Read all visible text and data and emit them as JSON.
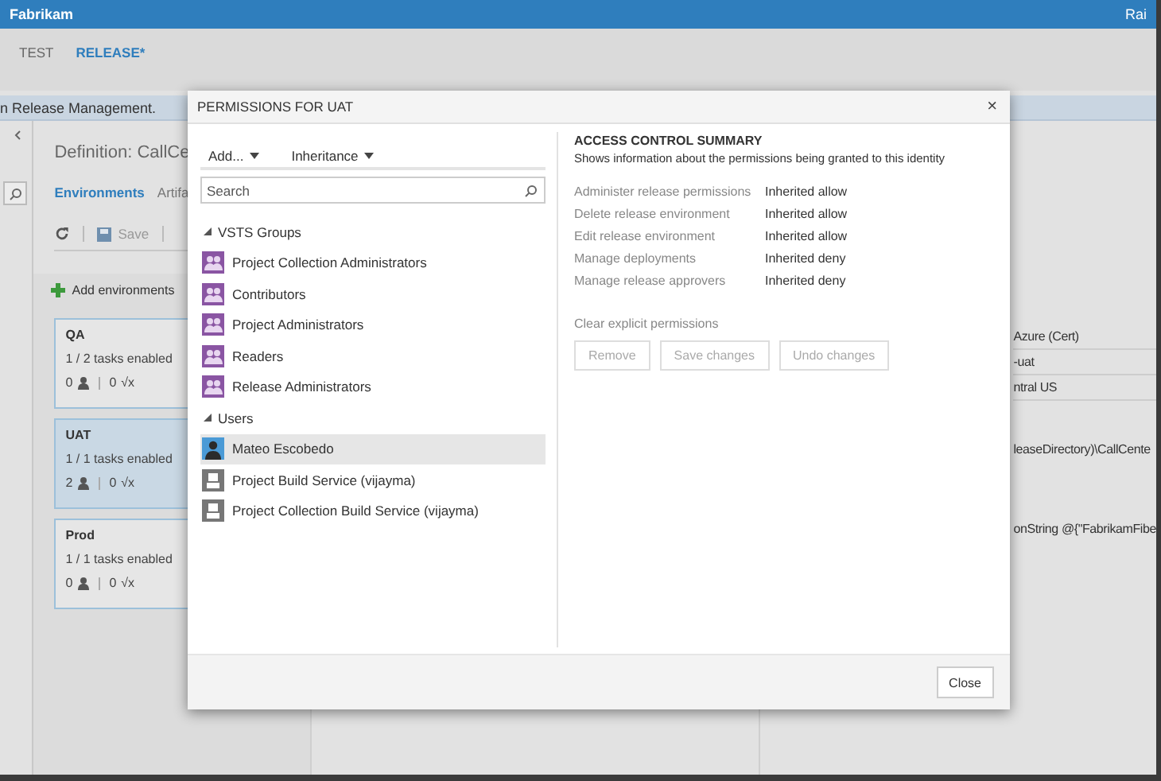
{
  "app": {
    "brand": "Fabrikam",
    "user": "Rai",
    "nav": [
      {
        "label": "TEST",
        "selected": false
      },
      {
        "label": "RELEASE*",
        "selected": true
      }
    ],
    "banner": "n Release Management.",
    "definition_title": "Definition: CallCe",
    "tabs": [
      {
        "label": "Environments",
        "selected": true
      },
      {
        "label": "Artifa",
        "selected": false
      }
    ],
    "toolbar": {
      "save": "Save"
    },
    "add_environments": "Add environments",
    "environments": [
      {
        "name": "QA",
        "tasks": "1 / 2 tasks enabled",
        "approvers": "0",
        "variables": "0",
        "variables_icon": "√x",
        "selected": false
      },
      {
        "name": "UAT",
        "tasks": "1 / 1 tasks enabled",
        "approvers": "2",
        "variables": "0",
        "variables_icon": "√x",
        "selected": true
      },
      {
        "name": "Prod",
        "tasks": "1 / 1 tasks enabled",
        "approvers": "0",
        "variables": "0",
        "variables_icon": "√x",
        "selected": false
      }
    ],
    "properties": [
      "Azure (Cert)",
      "-uat",
      "ntral US",
      "leaseDirectory)\\CallCente",
      "onString @{\"FabrikamFibe"
    ]
  },
  "dialog": {
    "title": "PERMISSIONS FOR UAT",
    "close": "×",
    "menus": [
      "Add...",
      "Inheritance"
    ],
    "search": {
      "placeholder": "Search"
    },
    "groups": [
      {
        "label": "VSTS Groups",
        "expanded": true,
        "children": [
          {
            "name": "Project Collection Administrators",
            "kind": "group",
            "selected": false
          },
          {
            "name": "Contributors",
            "kind": "group",
            "selected": false
          },
          {
            "name": "Project Administrators",
            "kind": "group",
            "selected": false
          },
          {
            "name": "Readers",
            "kind": "group",
            "selected": false
          },
          {
            "name": "Release Administrators",
            "kind": "group",
            "selected": false
          }
        ]
      },
      {
        "label": "Users",
        "expanded": true,
        "children": [
          {
            "name": "Mateo Escobedo",
            "kind": "user",
            "selected": true
          },
          {
            "name": "Project Build Service (vijayma)",
            "kind": "service",
            "selected": false
          },
          {
            "name": "Project Collection Build Service (vijayma)",
            "kind": "service",
            "selected": false
          }
        ]
      }
    ],
    "summary": {
      "title": "ACCESS CONTROL SUMMARY",
      "subtitle": "Shows information about the permissions being granted to this identity",
      "permissions": [
        {
          "name": "Administer release permissions",
          "value": "Inherited allow"
        },
        {
          "name": "Delete release environment",
          "value": "Inherited allow"
        },
        {
          "name": "Edit release environment",
          "value": "Inherited allow"
        },
        {
          "name": "Manage deployments",
          "value": "Inherited deny"
        },
        {
          "name": "Manage release approvers",
          "value": "Inherited deny"
        }
      ],
      "clear": "Clear explicit permissions",
      "buttons": [
        {
          "label": "Remove",
          "disabled": true
        },
        {
          "label": "Save changes",
          "disabled": true
        },
        {
          "label": "Undo changes",
          "disabled": true
        }
      ]
    },
    "footer": {
      "close": "Close"
    }
  }
}
